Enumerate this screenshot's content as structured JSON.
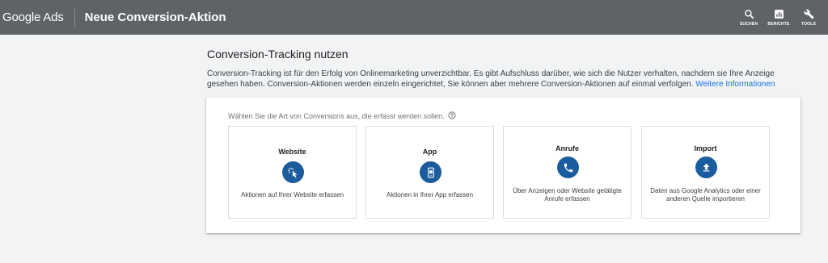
{
  "header": {
    "brand": "Google Ads",
    "title": "Neue Conversion-Aktion",
    "actions": [
      {
        "label": "SUCHEN",
        "icon": "search-icon"
      },
      {
        "label": "BERICHTE",
        "icon": "reports-icon"
      },
      {
        "label": "TOOLS",
        "icon": "wrench-icon"
      }
    ]
  },
  "main": {
    "heading": "Conversion-Tracking nutzen",
    "description": "Conversion-Tracking ist für den Erfolg von Onlinemarketing unverzichtbar. Es gibt Aufschluss darüber, wie sich die Nutzer verhalten, nachdem sie Ihre Anzeige gesehen haben. Conversion-Aktionen werden einzeln eingerichtet, Sie können aber mehrere Conversion-Aktionen auf einmal verfolgen.",
    "more_link": "Weitere Informationen",
    "prompt": "Wählen Sie die Art von Conversions aus, die erfasst werden sollen.",
    "options": [
      {
        "title": "Website",
        "icon": "cursor-click-icon",
        "text": "Aktionen auf Ihrer Website erfassen"
      },
      {
        "title": "App",
        "icon": "mobile-app-icon",
        "text": "Aktionen in Ihrer App erfassen"
      },
      {
        "title": "Anrufe",
        "icon": "phone-icon",
        "text": "Über Anzeigen oder Website getätigte Anrufe erfassen"
      },
      {
        "title": "Import",
        "icon": "upload-icon",
        "text": "Daten aus Google Analytics oder einer anderen Quelle importieren"
      }
    ]
  },
  "colors": {
    "topbar": "#5f6368",
    "accent": "#1a5c9e",
    "link": "#1a73e8",
    "background": "#f1f3f4"
  }
}
